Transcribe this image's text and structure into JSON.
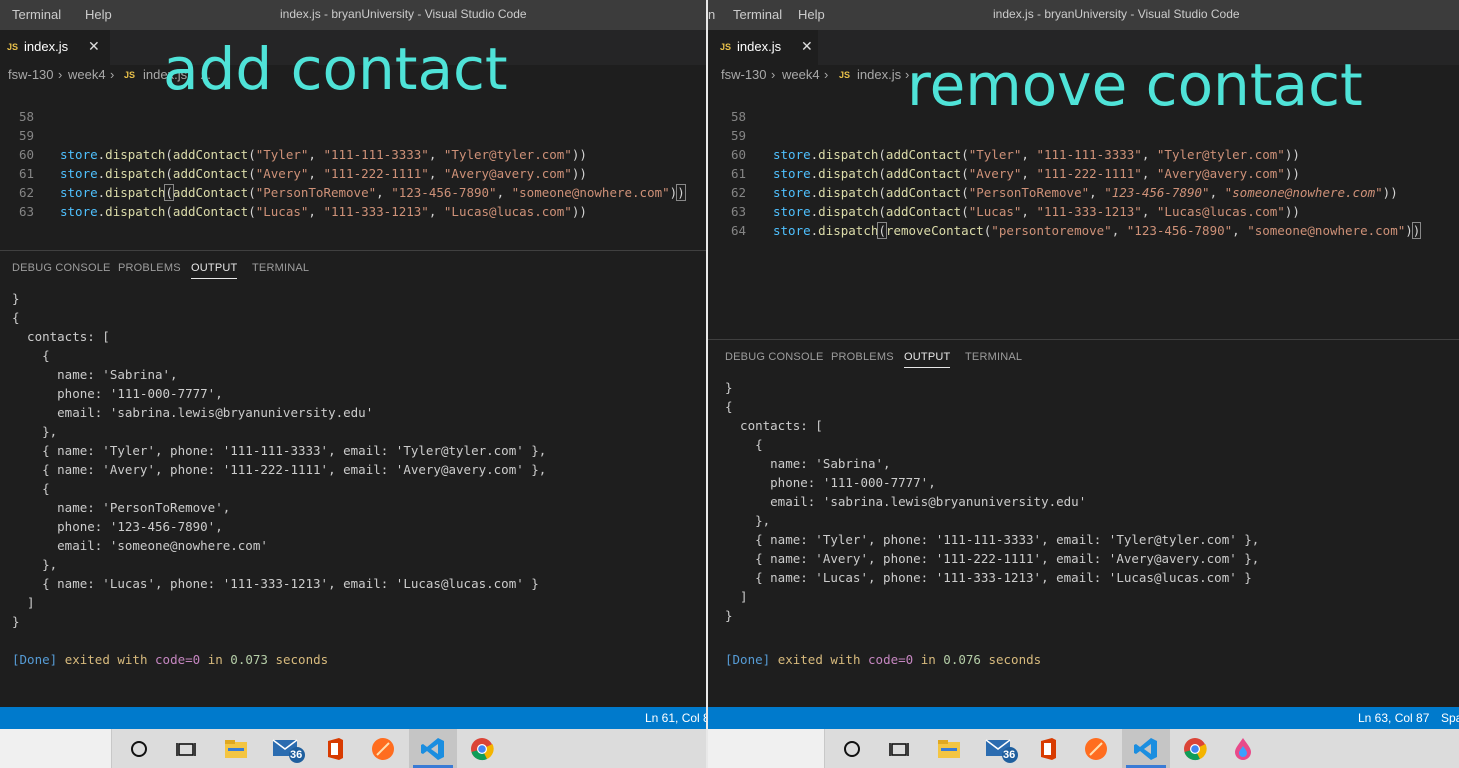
{
  "left": {
    "menu": [
      "Terminal",
      "Help"
    ],
    "title": "index.js - bryanUniversity - Visual Studio Code",
    "tab": {
      "badge": "JS",
      "name": "index.js",
      "close": "✕"
    },
    "breadcrumb": {
      "folder1": "fsw-130",
      "folder2": "week4",
      "badge": "JS",
      "file": "index.js",
      "tail": "..."
    },
    "overlay": "add contact",
    "code_lines": [
      {
        "num": "58",
        "text": ""
      },
      {
        "num": "59",
        "args": [
          "\"Tyler\"",
          "\"111-111-3333\"",
          "\"Tyler@tyler.com\""
        ]
      },
      {
        "num": "60",
        "args": [
          "\"Avery\"",
          "\"111-222-1111\"",
          "\"Avery@avery.com\""
        ]
      },
      {
        "num": "61",
        "args": [
          "\"PersonToRemove\"",
          "\"123-456-7890\"",
          "\"someone@nowhere.com\""
        ]
      },
      {
        "num": "62",
        "args": [
          "\"Lucas\"",
          "\"111-333-1213\"",
          "\"Lucas@lucas.com\""
        ]
      },
      {
        "num": "63",
        "text": ""
      }
    ],
    "panel_tabs": [
      "DEBUG CONSOLE",
      "PROBLEMS",
      "OUTPUT",
      "TERMINAL"
    ],
    "output_lines": [
      "}",
      "{",
      "  contacts: [",
      "    {",
      "      name: 'Sabrina',",
      "      phone: '111-000-7777',",
      "      email: 'sabrina.lewis@bryanuniversity.edu'",
      "    },",
      "    { name: 'Tyler', phone: '111-111-3333', email: 'Tyler@tyler.com' },",
      "    { name: 'Avery', phone: '111-222-1111', email: 'Avery@avery.com' },",
      "    {",
      "      name: 'PersonToRemove',",
      "      phone: '123-456-7890',",
      "      email: 'someone@nowhere.com'",
      "    },",
      "    { name: 'Lucas', phone: '111-333-1213', email: 'Lucas@lucas.com' }",
      "  ]",
      "}"
    ],
    "done": {
      "tag": "[Done]",
      "text": "exited with",
      "code": "code=0",
      "in": "in",
      "secs": "0.073",
      "unit": "seconds"
    },
    "status": "Ln 61, Col 8"
  },
  "right": {
    "menu_cut": "n",
    "menu": [
      "Terminal",
      "Help"
    ],
    "title": "index.js - bryanUniversity - Visual Studio Code",
    "tab": {
      "badge": "JS",
      "name": "index.js",
      "close": "✕"
    },
    "breadcrumb": {
      "folder1": "fsw-130",
      "folder2": "week4",
      "badge": "JS",
      "file": "index.js"
    },
    "overlay": "remove contact",
    "code_lines": [
      {
        "num": "58",
        "text": ""
      },
      {
        "num": "59",
        "fn": "addContact",
        "args": [
          "\"Tyler\"",
          "\"111-111-3333\"",
          "\"Tyler@tyler.com\""
        ]
      },
      {
        "num": "60",
        "fn": "addContact",
        "args": [
          "\"Avery\"",
          "\"111-222-1111\"",
          "\"Avery@avery.com\""
        ]
      },
      {
        "num": "61",
        "fn": "addContact",
        "args": [
          "\"PersonToRemove\"",
          "\"123-456-7890\"",
          "\"someone@nowhere.com\""
        ]
      },
      {
        "num": "62",
        "fn": "addContact",
        "args": [
          "\"Lucas\"",
          "\"111-333-1213\"",
          "\"Lucas@lucas.com\""
        ]
      },
      {
        "num": "63",
        "fn": "removeContact",
        "args": [
          "\"persontoremove\"",
          "\"123-456-7890\"",
          "\"someone@nowhere.com\""
        ]
      },
      {
        "num": "64",
        "text": ""
      }
    ],
    "panel_tabs": [
      "DEBUG CONSOLE",
      "PROBLEMS",
      "OUTPUT",
      "TERMINAL"
    ],
    "output_lines": [
      "}",
      "{",
      "  contacts: [",
      "    {",
      "      name: 'Sabrina',",
      "      phone: '111-000-7777',",
      "      email: 'sabrina.lewis@bryanuniversity.edu'",
      "    },",
      "    { name: 'Tyler', phone: '111-111-3333', email: 'Tyler@tyler.com' },",
      "    { name: 'Avery', phone: '111-222-1111', email: 'Avery@avery.com' },",
      "    { name: 'Lucas', phone: '111-333-1213', email: 'Lucas@lucas.com' }",
      "  ]",
      "}"
    ],
    "done": {
      "tag": "[Done]",
      "text": "exited with",
      "code": "code=0",
      "in": "in",
      "secs": "0.076",
      "unit": "seconds"
    },
    "status": "Ln 63, Col 87",
    "status_cut": "Spa"
  },
  "code": {
    "var": "store",
    "dispatch": "dispatch",
    "fn": "addContact"
  },
  "taskbar": {
    "mail_badge": "36",
    "icons": [
      "cortana-icon",
      "task-view-icon",
      "file-explorer-icon",
      "mail-icon",
      "office-icon",
      "firefox-icon",
      "vscode-icon",
      "chrome-icon"
    ]
  },
  "colors": {
    "accent": "#007acc",
    "overlay": "#4fe3d8",
    "editor_bg": "#1e1e1e"
  }
}
